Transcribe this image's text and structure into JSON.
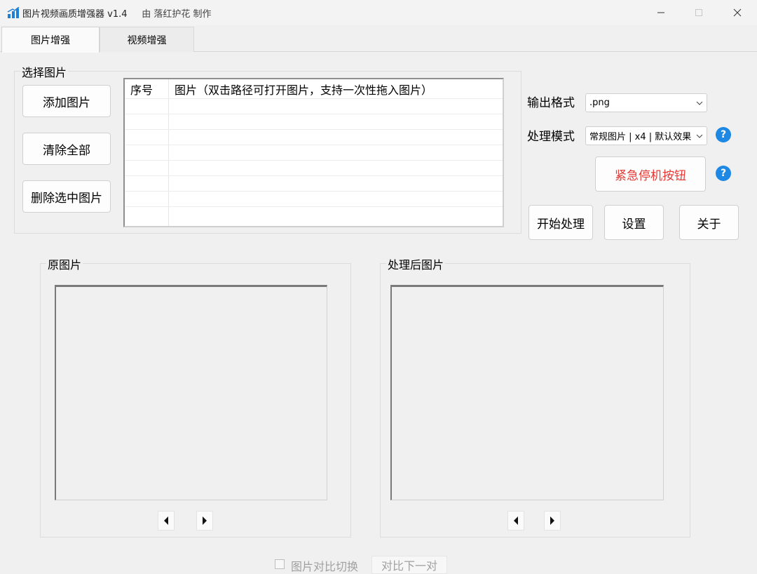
{
  "window": {
    "title": "图片视频画质增强器 v1.4",
    "author": "由 落红护花 制作"
  },
  "tabs": [
    {
      "label": "图片增强",
      "active": true
    },
    {
      "label": "视频增强",
      "active": false
    }
  ],
  "select_group": {
    "label": "选择图片",
    "add_button": "添加图片",
    "clear_button": "清除全部",
    "delete_button": "删除选中图片",
    "table": {
      "columns": [
        "序号",
        "图片（双击路径可打开图片，支持一次性拖入图片）"
      ],
      "rows": []
    }
  },
  "controls": {
    "output_format_label": "输出格式",
    "output_format_value": ".png",
    "mode_label": "处理模式",
    "mode_value": "常规图片 | x4 | 默认效果",
    "help_symbol": "?",
    "stop_button": "紧急停机按钮",
    "start_button": "开始处理",
    "settings_button": "设置",
    "about_button": "关于"
  },
  "preview": {
    "original_label": "原图片",
    "processed_label": "处理后图片"
  },
  "bottom": {
    "compare_checkbox_label": "图片对比切换",
    "compare_checked": false,
    "next_pair_button": "对比下一对"
  },
  "colors": {
    "background": "#f0f0f0",
    "stop_text": "#e53935",
    "help_icon": "#1e88e5",
    "disabled_text": "#a0a0a0"
  },
  "icons": [
    "app-icon",
    "minimize-icon",
    "maximize-icon",
    "close-icon",
    "chevron-down-icon",
    "help-icon",
    "arrow-left-icon",
    "arrow-right-icon"
  ]
}
